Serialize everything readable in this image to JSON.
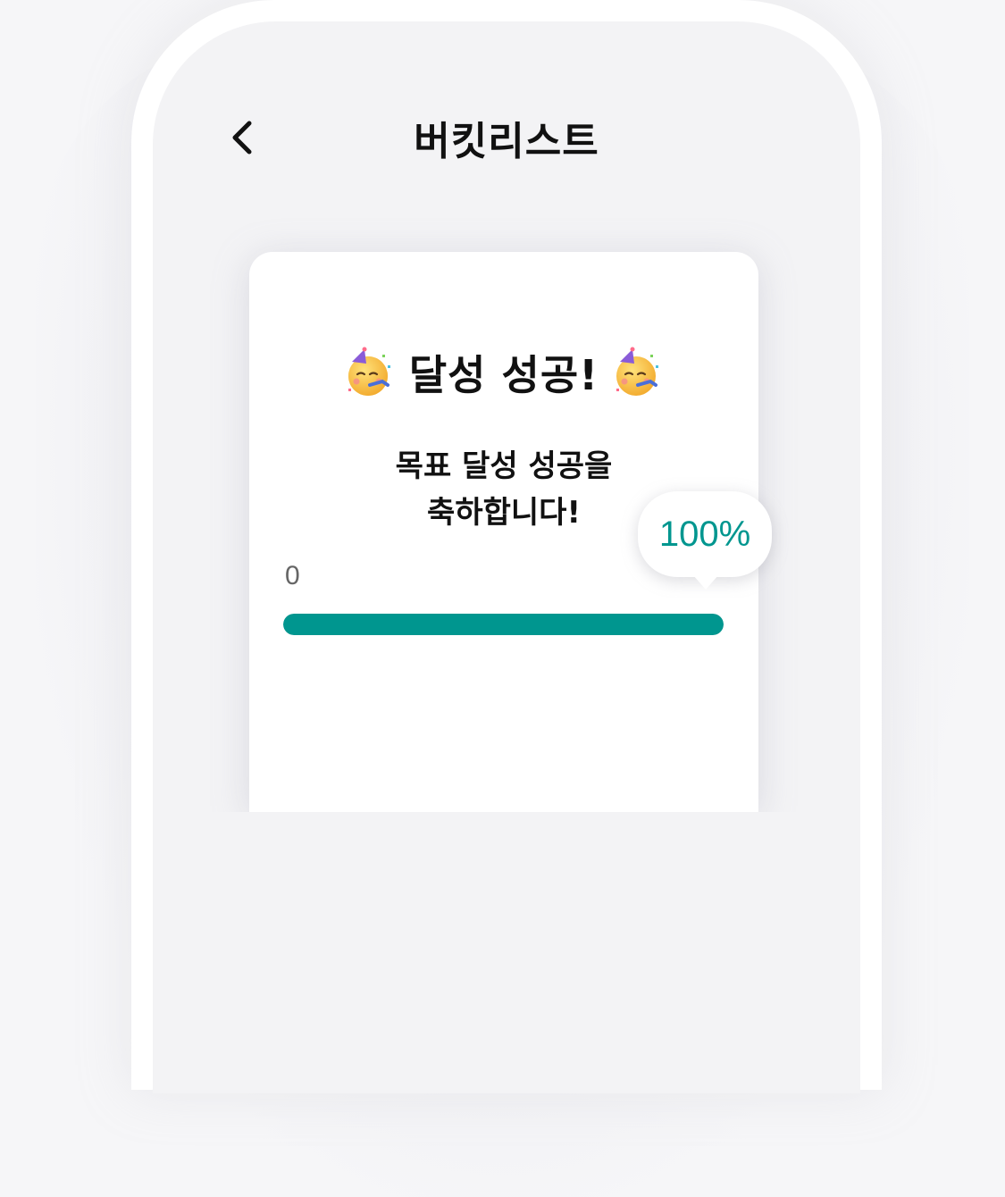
{
  "header": {
    "title": "버킷리스트",
    "back_icon": "chevron-left-icon"
  },
  "card": {
    "title": "달성 성공!",
    "emoji_icon": "partying-face-icon",
    "message_line1": "목표 달성 성공을",
    "message_line2": "축하합니다!"
  },
  "progress": {
    "min_label": "0",
    "value_percent": 100,
    "tooltip_text": "100%",
    "fill_color": "#00968f"
  },
  "colors": {
    "accent": "#00968f",
    "screen_background": "#f3f3f5",
    "card_background": "#ffffff"
  }
}
